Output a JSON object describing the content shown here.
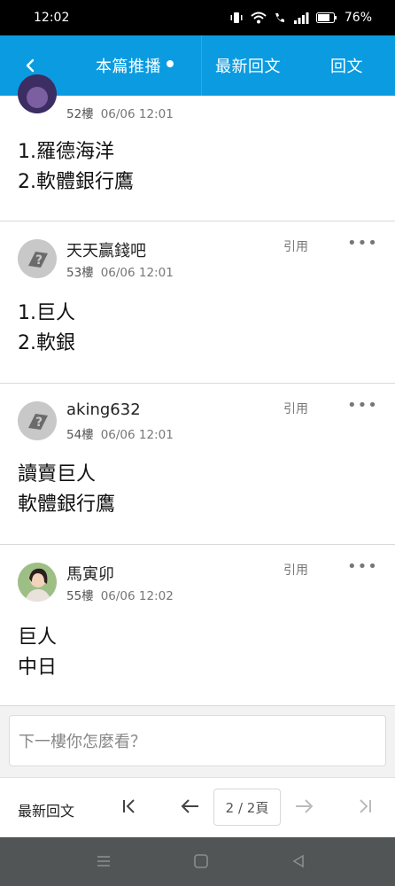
{
  "status_bar": {
    "time": "12:02",
    "battery": "76%"
  },
  "header": {
    "recommend_tab": "本篇推播",
    "latest_tab": "最新回文",
    "reply_tab": "回文"
  },
  "posts": [
    {
      "floor": "52樓",
      "time": "06/06 12:01",
      "lines": [
        "1.羅德海洋",
        "2.軟體銀行鷹"
      ]
    },
    {
      "author": "天天贏錢吧",
      "floor": "53樓",
      "time": "06/06 12:01",
      "quote": "引用",
      "more": "•••",
      "lines": [
        "1.巨人",
        "2.軟銀"
      ]
    },
    {
      "author": "aking632",
      "floor": "54樓",
      "time": "06/06 12:01",
      "quote": "引用",
      "more": "•••",
      "lines": [
        "讀賣巨人",
        "軟體銀行鷹"
      ]
    },
    {
      "author": "馬寅卯",
      "floor": "55樓",
      "time": "06/06 12:02",
      "quote": "引用",
      "more": "•••",
      "lines": [
        "巨人",
        "中日"
      ]
    }
  ],
  "comment": {
    "placeholder": "下一樓你怎麼看？"
  },
  "pager": {
    "latest_label": "最新回文",
    "page_indicator": "2 / 2頁"
  },
  "colors": {
    "header_bg": "#0b9be0",
    "nav_bg": "#525556",
    "status_bg": "#000000"
  }
}
